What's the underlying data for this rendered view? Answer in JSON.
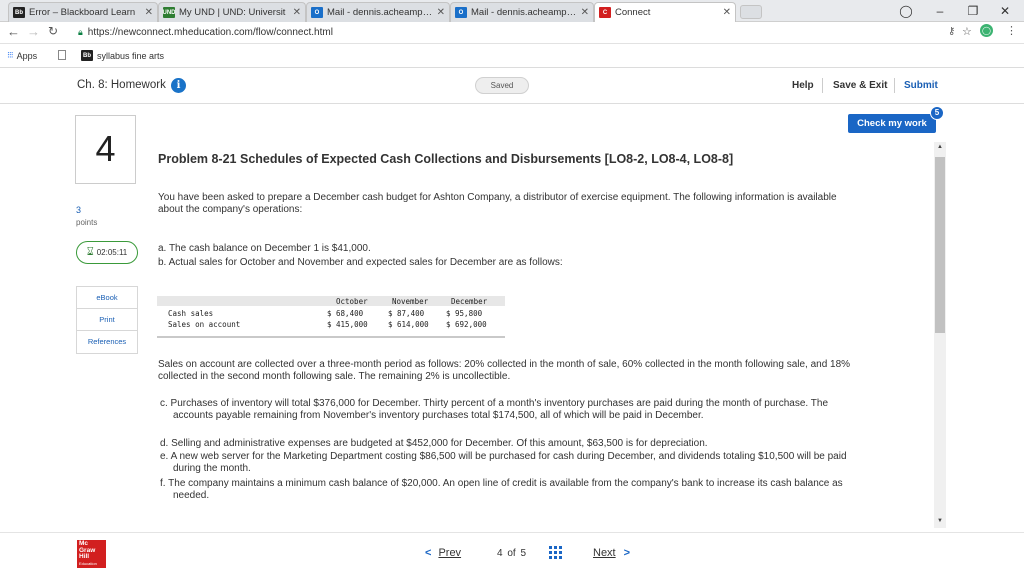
{
  "browser": {
    "tabs": [
      {
        "favicon": "Bb",
        "favicon_color": "#222222",
        "title": "Error – Blackboard Learn"
      },
      {
        "favicon": "UND",
        "favicon_color": "#2e7d32",
        "title": "My UND | UND: Universit"
      },
      {
        "favicon": "O",
        "favicon_color": "#1a6fc9",
        "title": "Mail - dennis.acheampon"
      },
      {
        "favicon": "O",
        "favicon_color": "#1a6fc9",
        "title": "Mail - dennis.acheampon"
      },
      {
        "favicon": "C",
        "favicon_color": "#d21f1f",
        "title": "Connect"
      }
    ],
    "url": "https://newconnect.mheducation.com/flow/connect.html",
    "bookmarks": [
      {
        "label": "Apps"
      },
      {
        "label": ""
      },
      {
        "label": "syllabus fine arts"
      }
    ]
  },
  "header": {
    "chapter_title": "Ch. 8: Homework",
    "saved_label": "Saved",
    "help": "Help",
    "save_exit": "Save & Exit",
    "submit": "Submit"
  },
  "sidebar": {
    "question_number": "4",
    "points_value": "3",
    "points_label": "points",
    "timer": "02:05:11",
    "tools": [
      "eBook",
      "Print",
      "References"
    ]
  },
  "content": {
    "check_work": "Check my work",
    "check_work_badge": "5",
    "problem_title": "Problem 8-21 Schedules of Expected Cash Collections and Disbursements [LO8-2, LO8-4, LO8-8]",
    "intro": "You have been asked to prepare a December cash budget for Ashton Company, a distributor of exercise equipment. The following information is available about the company's operations:",
    "item_a": "a. The cash balance on December 1 is $41,000.",
    "item_b": "b. Actual sales for October and November and expected sales for December are as follows:",
    "table": {
      "columns": [
        "October",
        "November",
        "December"
      ],
      "rows": [
        {
          "label": "Cash sales",
          "values": [
            "$  68,400",
            "$  87,400",
            "$  95,800"
          ]
        },
        {
          "label": "Sales on account",
          "values": [
            "$ 415,000",
            "$ 614,000",
            "$ 692,000"
          ]
        }
      ]
    },
    "collections": "Sales on account are collected over a three-month period as follows: 20% collected in the month of sale, 60% collected in the month following sale, and 18% collected in the second month following sale. The remaining 2% is uncollectible.",
    "item_c": "c. Purchases of inventory will total $376,000 for December. Thirty percent of a month's inventory purchases are paid during the month of purchase. The accounts payable remaining from November's inventory purchases total $174,500, all of which will be paid in December.",
    "item_d": "d. Selling and administrative expenses are budgeted at $452,000 for December. Of this amount, $63,500 is for depreciation.",
    "item_e": "e. A new web server for the Marketing Department costing $86,500 will be purchased for cash during December, and dividends totaling $10,500 will be paid during the month.",
    "item_f": "f. The company maintains a minimum cash balance of $20,000. An open line of credit is available from the company's bank to increase its cash balance as needed."
  },
  "footer": {
    "logo": [
      "Mc",
      "Graw",
      "Hill"
    ],
    "logo_sub": "Education",
    "prev": "Prev",
    "page_current": "4",
    "page_of": "of",
    "page_total": "5",
    "next": "Next"
  }
}
